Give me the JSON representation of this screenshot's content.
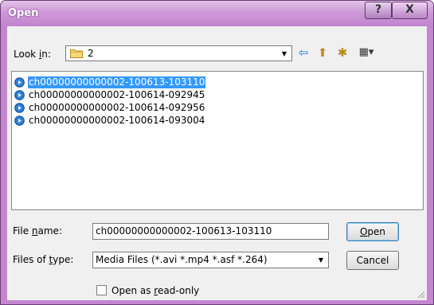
{
  "window": {
    "title": "Open",
    "help_glyph": "?",
    "close_glyph": "X"
  },
  "lookin": {
    "label_pre": "Look ",
    "label_mn": "i",
    "label_post": "n:",
    "value": "2",
    "dropdown_glyph": "▼"
  },
  "toolbar": {
    "back_glyph": "⇦",
    "up_glyph": "⬆",
    "newfolder_glyph": "✱",
    "views_glyph": "▦▾"
  },
  "files": [
    {
      "name": "ch00000000000002-100613-103110",
      "selected": true
    },
    {
      "name": "ch00000000000002-100614-092945",
      "selected": false
    },
    {
      "name": "ch00000000000002-100614-092956",
      "selected": false
    },
    {
      "name": "ch00000000000002-100614-093004",
      "selected": false
    }
  ],
  "filename": {
    "label_pre": "File ",
    "label_mn": "n",
    "label_post": "ame:",
    "value": "ch00000000000002-100613-103110"
  },
  "filetype": {
    "label_pre": "Files of ",
    "label_mn": "t",
    "label_post": "ype:",
    "value": "Media Files (*.avi *.mp4 *.asf *.264)",
    "dropdown_glyph": "▼"
  },
  "buttons": {
    "open_mn": "O",
    "open_rest": "pen",
    "cancel": "Cancel"
  },
  "readonly": {
    "label_pre": "Open as ",
    "label_mn": "r",
    "label_post": "ead-only",
    "checked": false
  },
  "colors": {
    "frame": "#c487cf",
    "selection": "#3399ff",
    "client": "#f0f0f0"
  }
}
